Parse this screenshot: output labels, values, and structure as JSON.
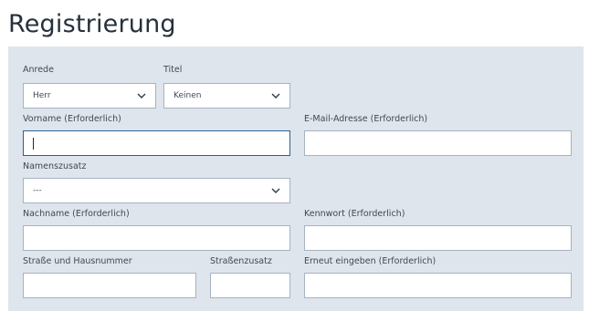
{
  "page": {
    "title": "Registrierung"
  },
  "form": {
    "anrede": {
      "label": "Anrede",
      "value": "Herr"
    },
    "titel": {
      "label": "Titel",
      "value": "Keinen"
    },
    "vorname": {
      "label": "Vorname (Erforderlich)",
      "value": ""
    },
    "email": {
      "label": "E-Mail-Adresse (Erforderlich)",
      "value": ""
    },
    "namenszusatz": {
      "label": "Namenszusatz",
      "value": "---"
    },
    "nachname": {
      "label": "Nachname (Erforderlich)",
      "value": ""
    },
    "kennwort": {
      "label": "Kennwort (Erforderlich)",
      "value": ""
    },
    "strasse": {
      "label": "Straße und Hausnummer",
      "value": ""
    },
    "strassenzusatz": {
      "label": "Straßenzusatz",
      "value": ""
    },
    "kennwort_repeat": {
      "label": "Erneut eingeben (Erforderlich)",
      "value": ""
    }
  },
  "icons": {
    "dropdown": "chevron-down-icon"
  },
  "colors": {
    "panel_background": "#dfe5ec",
    "field_border": "#a7b3bf",
    "focus_border": "#2e5f96"
  }
}
